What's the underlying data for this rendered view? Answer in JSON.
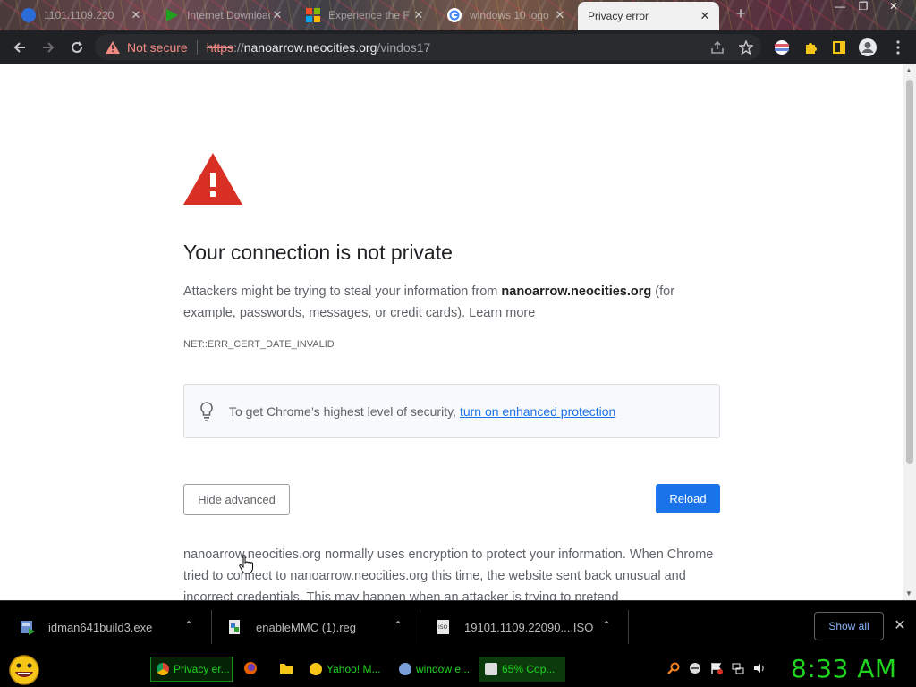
{
  "tabs": [
    {
      "title": "1101.1109.220",
      "favicon_color": "#2b6cd9"
    },
    {
      "title": "Internet Download",
      "favicon_color": "#1fa01f"
    },
    {
      "title": "Experience the F",
      "favicon_color": "#e8612c"
    },
    {
      "title": "windows 10 logo",
      "favicon_color": "#4285f4"
    },
    {
      "title": "Privacy error",
      "favicon_color": ""
    }
  ],
  "window_controls": {
    "minimize": "—",
    "restore": "❐",
    "close": "✕"
  },
  "toolbar": {
    "security_label": "Not secure",
    "url_scheme": "https",
    "url_separator": "://",
    "url_host": "nanoarrow.neocities.org",
    "url_path": "/vindos17"
  },
  "page": {
    "heading": "Your connection is not private",
    "desc_prefix": "Attackers might be trying to steal your information from ",
    "desc_host": "nanoarrow.neocities.org",
    "desc_suffix": " (for example, passwords, messages, or credit cards). ",
    "learn_more": "Learn more",
    "error_code": "NET::ERR_CERT_DATE_INVALID",
    "protection_text": "To get Chrome’s highest level of security,",
    "protection_link": "turn on enhanced protection",
    "hide_advanced": "Hide advanced",
    "reload": "Reload",
    "details": "nanoarrow.neocities.org normally uses encryption to protect your information. When Chrome tried to connect to nanoarrow.neocities.org this time, the website sent back unusual and incorrect credentials. This may happen when an attacker is trying to pretend"
  },
  "downloads": {
    "items": [
      {
        "name": "idman641build3.exe"
      },
      {
        "name": "enableMMC (1).reg"
      },
      {
        "name": "19101.1109.22090....ISO"
      }
    ],
    "show_all": "Show all"
  },
  "taskbar": {
    "buttons": [
      {
        "label": "Privacy er...",
        "icon_color": "#4285f4"
      },
      {
        "label": "Yahoo! M...",
        "icon_color": "#f5c518"
      },
      {
        "label": "window e...",
        "icon_color": "#7a9fd8"
      },
      {
        "label": "65% Cop...",
        "icon_color": "#dddddd"
      }
    ],
    "clock": "8:33 AM"
  },
  "colors": {
    "accent_blue": "#1a73e8",
    "warning_red": "#d93025",
    "taskbar_green": "#1fd41f",
    "not_secure_red": "#f28b82"
  }
}
